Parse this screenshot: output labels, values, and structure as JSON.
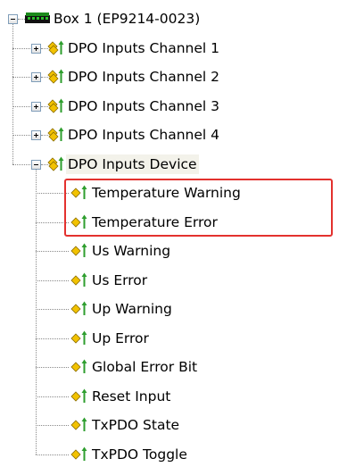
{
  "tree": {
    "root": {
      "label": "Box 1 (EP9214-0023)",
      "expanded": true,
      "icon": "ethercat-box-icon"
    },
    "channels": [
      {
        "label": "DPO Inputs Channel 1",
        "expanded": false,
        "icon": "pdo-input-icon"
      },
      {
        "label": "DPO Inputs Channel 2",
        "expanded": false,
        "icon": "pdo-input-icon"
      },
      {
        "label": "DPO Inputs Channel 3",
        "expanded": false,
        "icon": "pdo-input-icon"
      },
      {
        "label": "DPO Inputs Channel 4",
        "expanded": false,
        "icon": "pdo-input-icon"
      }
    ],
    "device": {
      "label": "DPO Inputs Device",
      "expanded": true,
      "icon": "pdo-input-icon",
      "items": [
        {
          "label": "Temperature Warning",
          "icon": "input-variable-icon"
        },
        {
          "label": "Temperature Error",
          "icon": "input-variable-icon"
        },
        {
          "label": "Us Warning",
          "icon": "input-variable-icon"
        },
        {
          "label": "Us Error",
          "icon": "input-variable-icon"
        },
        {
          "label": "Up Warning",
          "icon": "input-variable-icon"
        },
        {
          "label": "Up Error",
          "icon": "input-variable-icon"
        },
        {
          "label": "Global Error Bit",
          "icon": "input-variable-icon"
        },
        {
          "label": "Reset Input",
          "icon": "input-variable-icon"
        },
        {
          "label": "TxPDO State",
          "icon": "input-variable-icon"
        },
        {
          "label": "TxPDO Toggle",
          "icon": "input-variable-icon"
        }
      ]
    },
    "highlighted_items": [
      "Temperature Warning",
      "Temperature Error"
    ]
  },
  "colors": {
    "highlight_border": "#e3312e",
    "tree_lines": "#8a8a8a",
    "box_icon_green": "#1c8a1c",
    "box_icon_black": "#111111",
    "pdo_icon_yellow": "#f2c200",
    "arrow_icon_green": "#2e9e2e"
  }
}
